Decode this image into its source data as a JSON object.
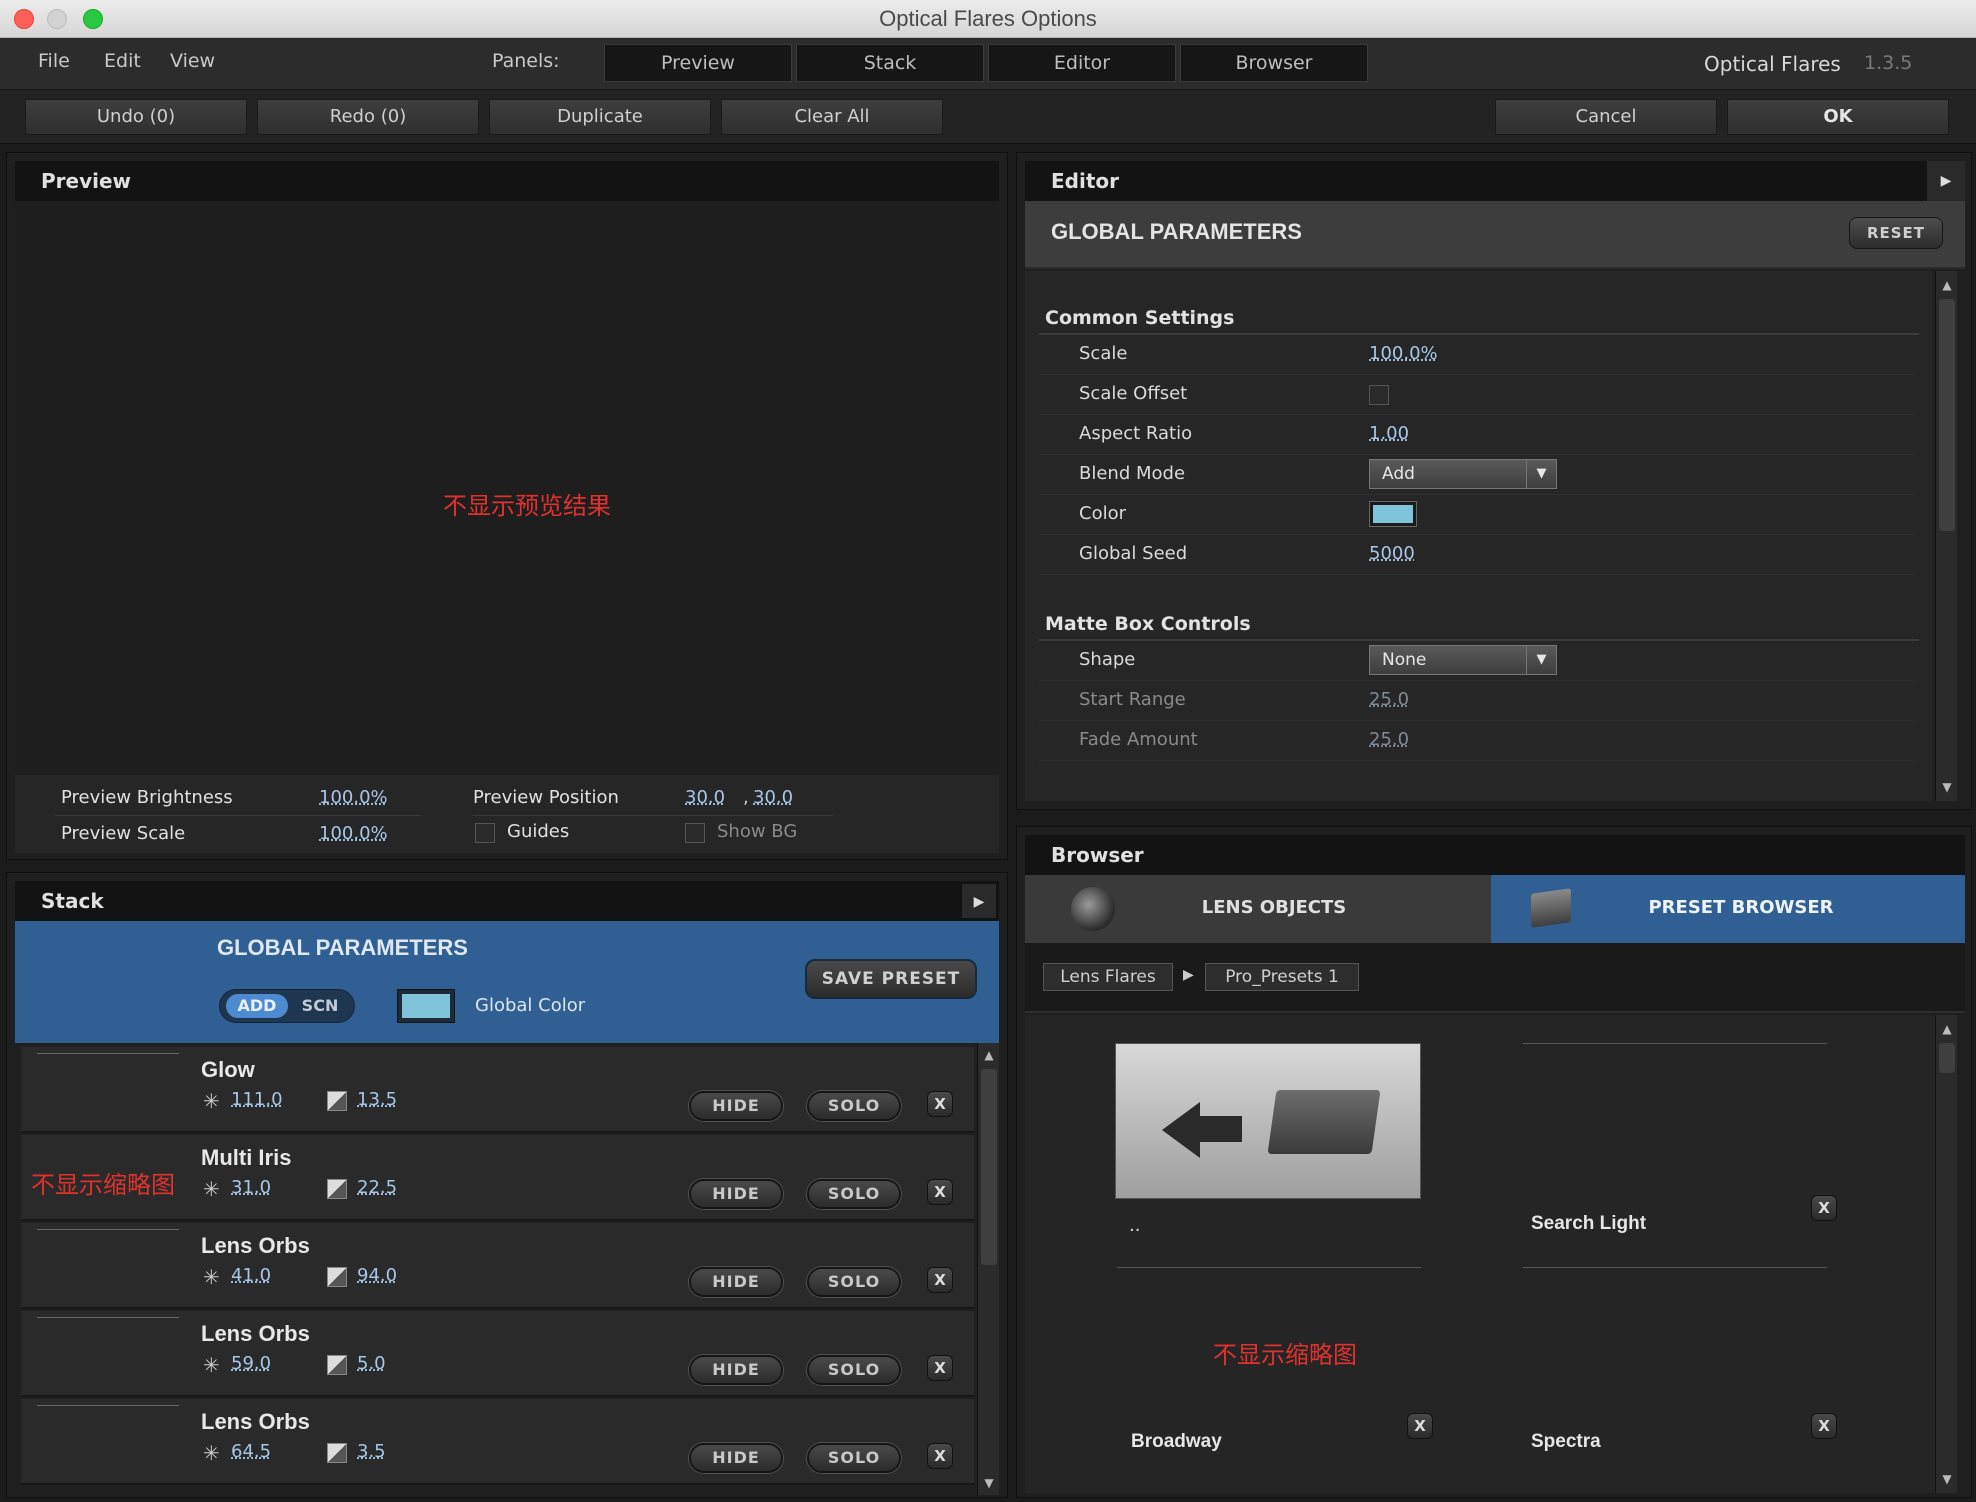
{
  "window": {
    "title": "Optical Flares Options"
  },
  "menu": {
    "items": [
      "File",
      "Edit",
      "View"
    ],
    "panels_label": "Panels:",
    "panel_tabs": [
      "Preview",
      "Stack",
      "Editor",
      "Browser"
    ],
    "app_name": "Optical Flares",
    "version": "1.3.5"
  },
  "toolbar": {
    "undo": "Undo (0)",
    "redo": "Redo (0)",
    "duplicate": "Duplicate",
    "clear_all": "Clear All",
    "cancel": "Cancel",
    "ok": "OK"
  },
  "preview": {
    "title": "Preview",
    "note": "不显示预览结果",
    "brightness_label": "Preview Brightness",
    "brightness_value": "100.0%",
    "scale_label": "Preview Scale",
    "scale_value": "100.0%",
    "position_label": "Preview Position",
    "position_x": "30.0",
    "position_y": "30.0",
    "guides_label": "Guides",
    "showbg_label": "Show BG"
  },
  "editor": {
    "title": "Editor",
    "section_title": "GLOBAL PARAMETERS",
    "reset": "RESET",
    "common_settings": "Common Settings",
    "rows": {
      "scale": {
        "label": "Scale",
        "value": "100.0%"
      },
      "scale_offset": {
        "label": "Scale Offset"
      },
      "aspect_ratio": {
        "label": "Aspect Ratio",
        "value": "1.00"
      },
      "blend_mode": {
        "label": "Blend Mode",
        "value": "Add"
      },
      "color": {
        "label": "Color",
        "swatch": "#7fc4da"
      },
      "global_seed": {
        "label": "Global Seed",
        "value": "5000"
      }
    },
    "matte_box": "Matte Box Controls",
    "matte_rows": {
      "shape": {
        "label": "Shape",
        "value": "None"
      },
      "start_range": {
        "label": "Start Range",
        "value": "25.0"
      },
      "fade_amount": {
        "label": "Fade Amount",
        "value": "25.0"
      }
    }
  },
  "stack": {
    "title": "Stack",
    "header": {
      "title": "GLOBAL PARAMETERS",
      "add": "ADD",
      "scn": "SCN",
      "global_color_label": "Global Color",
      "global_color": "#7fc4da",
      "save_preset": "SAVE PRESET"
    },
    "thumb_note": "不显示缩略图",
    "hide": "HIDE",
    "solo": "SOLO",
    "x": "X",
    "rows": [
      {
        "name": "Glow",
        "v1": "111.0",
        "v2": "13.5"
      },
      {
        "name": "Multi Iris",
        "v1": "31.0",
        "v2": "22.5"
      },
      {
        "name": "Lens Orbs",
        "v1": "41.0",
        "v2": "94.0"
      },
      {
        "name": "Lens Orbs",
        "v1": "59.0",
        "v2": "5.0"
      },
      {
        "name": "Lens Orbs",
        "v1": "64.5",
        "v2": "3.5"
      }
    ]
  },
  "browser": {
    "title": "Browser",
    "tab_lens": "LENS OBJECTS",
    "tab_preset": "PRESET BROWSER",
    "crumb1": "Lens Flares",
    "crumb2": "Pro_Presets 1",
    "items": {
      "up": "..",
      "search_light": "Search Light",
      "broadway": "Broadway",
      "spectra": "Spectra"
    },
    "note": "不显示缩略图",
    "x": "X"
  },
  "colors": {
    "accent_blue": "#2f5f93",
    "swatch": "#7fc4da"
  }
}
